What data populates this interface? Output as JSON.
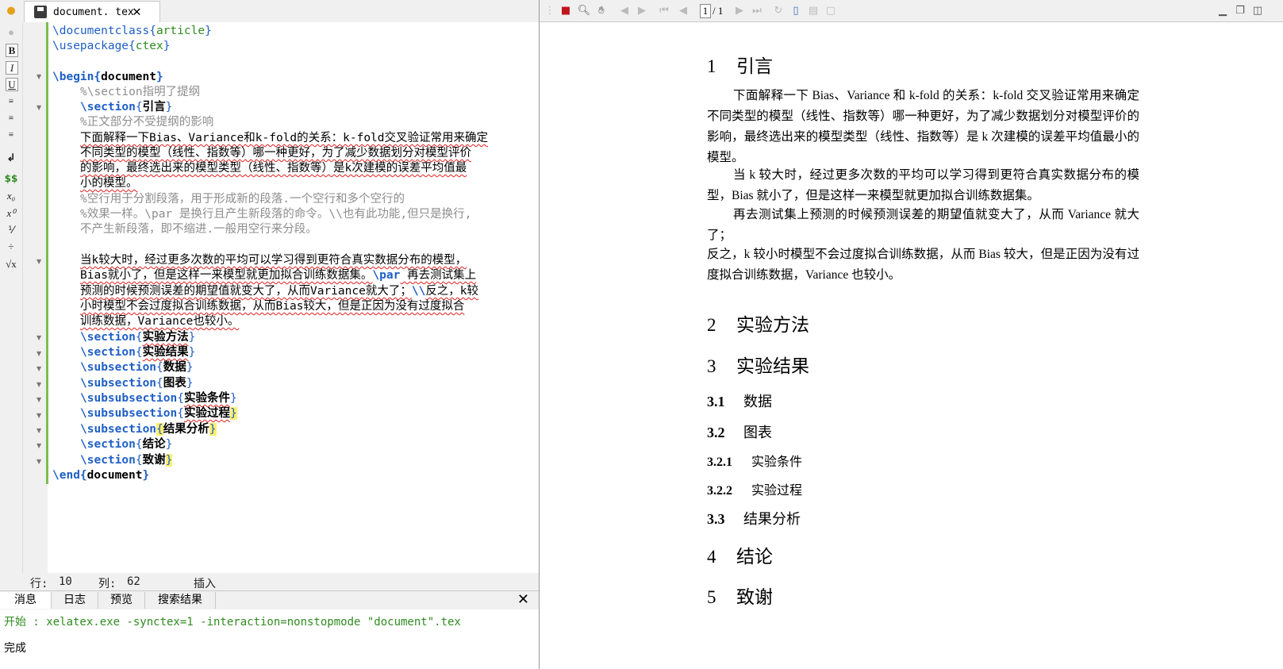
{
  "editor": {
    "tab_filename": "document. tex",
    "lines": {
      "l1": {
        "a": "\\documentclass",
        "b": "{",
        "c": "article",
        "d": "}"
      },
      "l2": {
        "a": "\\usepackage",
        "b": "{",
        "c": "ctex",
        "d": "}"
      },
      "l4": {
        "a": "\\begin",
        "b": "{",
        "c": "document",
        "d": "}"
      },
      "l5": "%\\section指明了提纲",
      "l6": {
        "a": "\\section",
        "b": "{",
        "c": "引言",
        "d": "}"
      },
      "l7": "%正文部分不受提纲的影响",
      "l8": "下面解释一下Bias、Variance和k-fold的关系：k-fold交叉验证常用来确定",
      "l9": "不同类型的模型（线性、指数等）哪一种更好，为了减少数据划分对模型评价",
      "l10": "的影响，最终选出来的模型类型（线性、指数等）是k次建模的误差平均值最",
      "l11": "小的模型。",
      "l12": "%空行用于分割段落，用于形成新的段落.一个空行和多个空行的",
      "l13": "%效果一样。\\par 是换行且产生新段落的命令。\\\\也有此功能,但只是换行,",
      "l14": "不产生新段落，即不缩进.一般用空行来分段。",
      "l16": "当k较大时，经过更多次数的平均可以学习得到更符合真实数据分布的模型，",
      "l17a": "Bias就小了，但是这样一来模型就更加拟合训练数据集。",
      "l17b": "\\par",
      "l17c": " 再去测试集上",
      "l18a": "预测的时候预测误差的期望值就变大了，从而Variance就大了；",
      "l18b": "\\\\",
      "l18c": "反之，k较",
      "l19": "小时模型不会过度拟合训练数据，从而Bias较大，但是正因为没有过度拟合",
      "l20": "训练数据，Variance也较小。",
      "l21": {
        "a": "\\section",
        "b": "{",
        "c": "实验方法",
        "d": "}"
      },
      "l22": {
        "a": "\\section",
        "b": "{",
        "c": "实验结果",
        "d": "}"
      },
      "l23": {
        "a": "\\subsection",
        "b": "{",
        "c": "数据",
        "d": "}"
      },
      "l24": {
        "a": "\\subsection",
        "b": "{",
        "c": "图表",
        "d": "}"
      },
      "l25": {
        "a": "\\subsubsection",
        "b": "{",
        "c": "实验条件",
        "d": "}"
      },
      "l26": {
        "a": "\\subsubsection",
        "b": "{",
        "c": "实验过程",
        "d": "}"
      },
      "l27": {
        "a": "\\subsection",
        "b": "{",
        "c": "结果分析",
        "d": "}"
      },
      "l28": {
        "a": "\\section",
        "b": "{",
        "c": "结论",
        "d": "}"
      },
      "l29": {
        "a": "\\section",
        "b": "{",
        "c": "致谢",
        "d": "}"
      },
      "l30": {
        "a": "\\end",
        "b": "{",
        "c": "document",
        "d": "}"
      }
    },
    "toolbar_icons": [
      "bold-icon",
      "italic-icon",
      "underline-icon",
      "align-left-icon",
      "align-center-icon",
      "align-right-icon",
      "newline-icon",
      "math-inline-icon",
      "subscript-icon",
      "superscript-icon",
      "fraction-icon",
      "frac-icon",
      "sqrt-icon"
    ],
    "toolbar_glyphs": {
      "bold": "B",
      "italic": "I",
      "underline": "U",
      "newline": "↲",
      "math": "$$",
      "sub": "x₀",
      "sup": "x⁰",
      "sqrt": "√x"
    }
  },
  "status": {
    "row_label": "行:",
    "row_value": "10",
    "col_label": "列:",
    "col_value": "62",
    "mode": "插入"
  },
  "messages": {
    "tabs": [
      "消息",
      "日志",
      "预览",
      "搜索结果"
    ],
    "command": "开始 : xelatex.exe -synctex=1 -interaction=nonstopmode \"document\".tex",
    "done": "完成"
  },
  "viewer": {
    "page_current": "1",
    "page_total": "/ 1",
    "sections": [
      {
        "num": "1",
        "title": "引言"
      },
      {
        "num": "2",
        "title": "实验方法"
      },
      {
        "num": "3",
        "title": "实验结果"
      },
      {
        "num": "4",
        "title": "结论"
      },
      {
        "num": "5",
        "title": "致谢"
      }
    ],
    "subsections": [
      {
        "num": "3.1",
        "title": "数据"
      },
      {
        "num": "3.2",
        "title": "图表"
      },
      {
        "num": "3.3",
        "title": "结果分析"
      }
    ],
    "subsubsections": [
      {
        "num": "3.2.1",
        "title": "实验条件"
      },
      {
        "num": "3.2.2",
        "title": "实验过程"
      }
    ],
    "paragraphs": [
      "下面解释一下 Bias、Variance 和 k-fold 的关系：k-fold 交叉验证常用来确定不同类型的模型（线性、指数等）哪一种更好，为了减少数据划分对模型评价的影响，最终选出来的模型类型（线性、指数等）是 k 次建模的误差平均值最小的模型。",
      "当 k 较大时，经过更多次数的平均可以学习得到更符合真实数据分布的模型，Bias 就小了，但是这样一来模型就更加拟合训练数据集。",
      "再去测试集上预测的时候预测误差的期望值就变大了，从而 Variance 就大了；",
      "反之，k 较小时模型不会过度拟合训练数据，从而 Bias 较大，但是正因为没有过度拟合训练数据，Variance 也较小。"
    ]
  },
  "colors": {
    "keyword": "#1f5fc6",
    "argument": "#2f8c1f",
    "comment": "#8d8d8d",
    "change_bar": "#7cbd52",
    "current_line": "#ececfc"
  }
}
